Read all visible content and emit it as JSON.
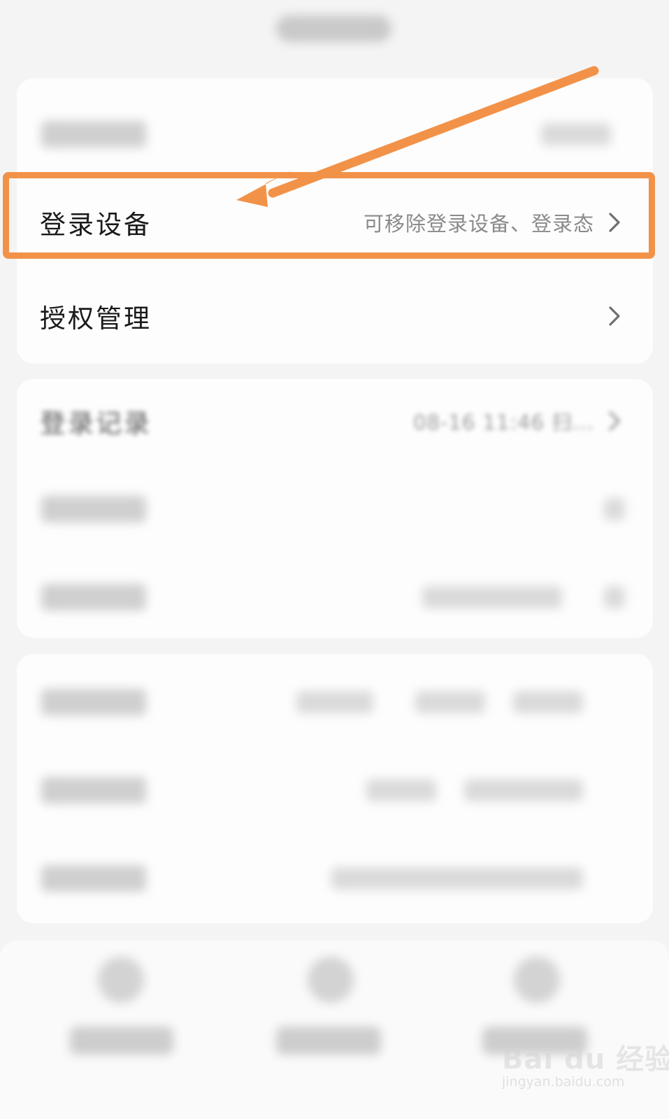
{
  "rows": {
    "login_devices": {
      "label": "登录设备",
      "value": "可移除登录设备、登录态"
    },
    "authorization": {
      "label": "授权管理"
    },
    "login_records": {
      "label": "登录记录",
      "value": "08-16 11:46 扫..."
    }
  },
  "annotation": {
    "highlight_color": "#f29248"
  },
  "watermark": {
    "brand": "Bai du 经验",
    "url": "jingyan.baidu.com"
  },
  "icons": {
    "chevron": "chevron-right-icon",
    "arrow": "annotation-arrow-icon"
  }
}
